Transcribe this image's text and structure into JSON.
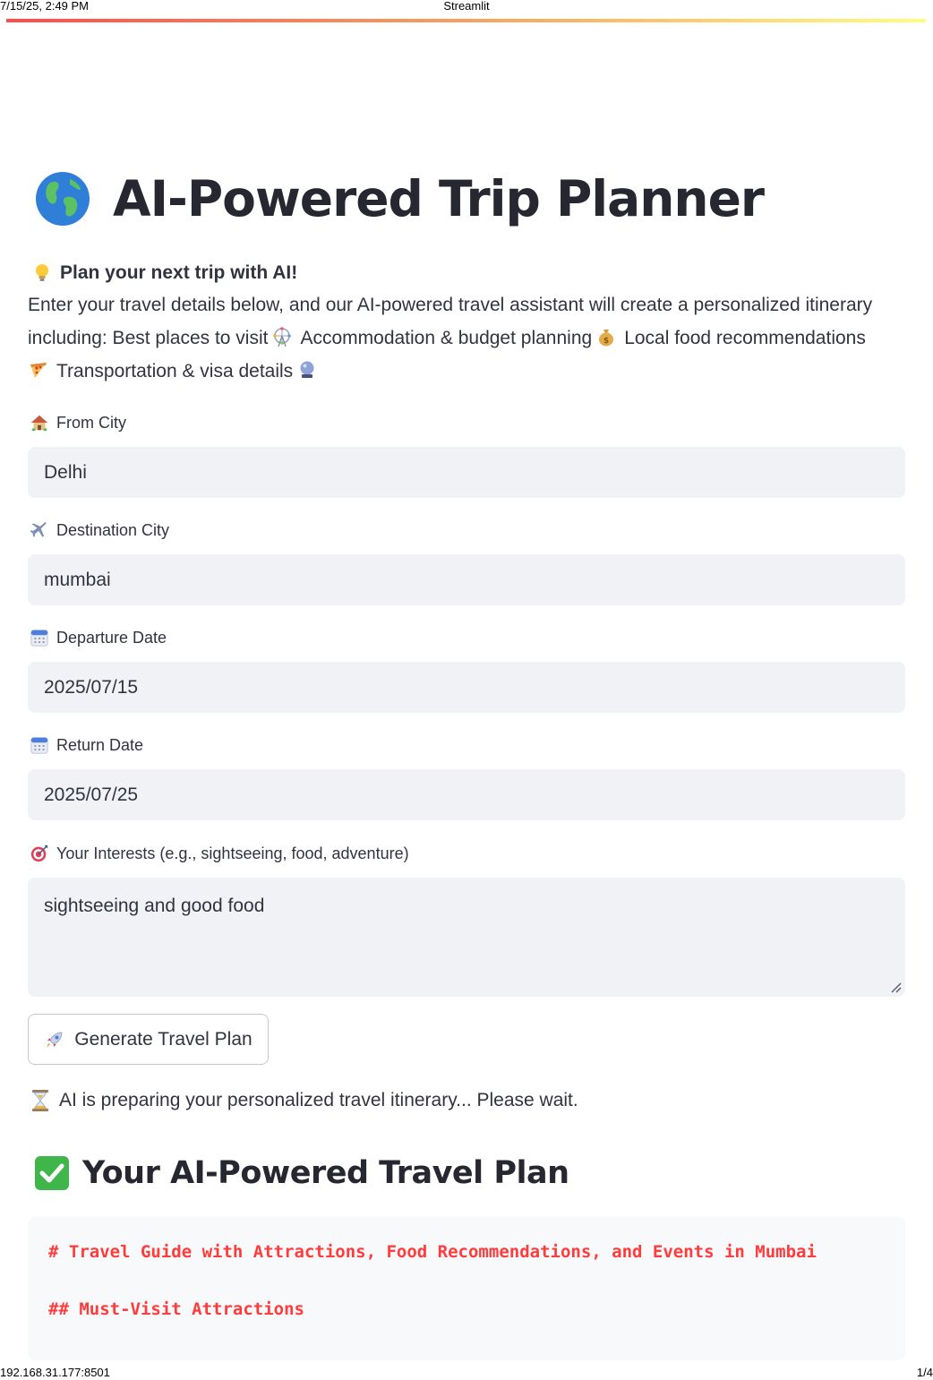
{
  "print": {
    "datetime": "7/15/25, 2:49 PM",
    "page_title": "Streamlit",
    "url": "192.168.31.177:8501",
    "page_number": "1/4"
  },
  "header": {
    "title_icon": "globe-icon",
    "title": "AI-Powered Trip Planner"
  },
  "intro": {
    "lead_icon": "lightbulb-icon",
    "lead": "Plan your next trip with AI!",
    "line1": "Enter your travel details below, and our AI-powered travel assistant will create a personalized itinerary",
    "line2_a": "including: Best places to visit",
    "line2_icon_a": "ferris-wheel-icon",
    "line2_b": "Accommodation & budget planning",
    "line2_icon_b": "money-bag-icon",
    "line2_c": "Local food recommendations",
    "line3_icon_a": "pizza-icon",
    "line3": "Transportation & visa details",
    "line3_icon_b": "crystal-ball-icon"
  },
  "form": {
    "from_city": {
      "icon": "house-icon",
      "label": "From City",
      "value": "Delhi"
    },
    "destination_city": {
      "icon": "airplane-icon",
      "label": "Destination City",
      "value": "mumbai"
    },
    "departure_date": {
      "icon": "calendar-icon",
      "label": "Departure Date",
      "value": "2025/07/15"
    },
    "return_date": {
      "icon": "calendar-icon",
      "label": "Return Date",
      "value": "2025/07/25"
    },
    "interests": {
      "icon": "target-icon",
      "label": "Your Interests (e.g., sightseeing, food, adventure)",
      "value": "sightseeing and good food"
    }
  },
  "button": {
    "icon": "rocket-icon",
    "label": "Generate Travel Plan"
  },
  "status": {
    "icon": "hourglass-icon",
    "text": "AI is preparing your personalized travel itinerary... Please wait."
  },
  "result": {
    "icon": "check-mark-icon",
    "title": "Your AI-Powered Travel Plan",
    "lines": [
      "# Travel Guide with Attractions, Food Recommendations, and Events in Mumbai",
      "## Must-Visit Attractions"
    ]
  },
  "colors": {
    "accent_start": "#ff4b4b",
    "accent_end": "#fffd80",
    "input_bg": "#f0f2f6",
    "code_text": "#ff3b3b"
  }
}
